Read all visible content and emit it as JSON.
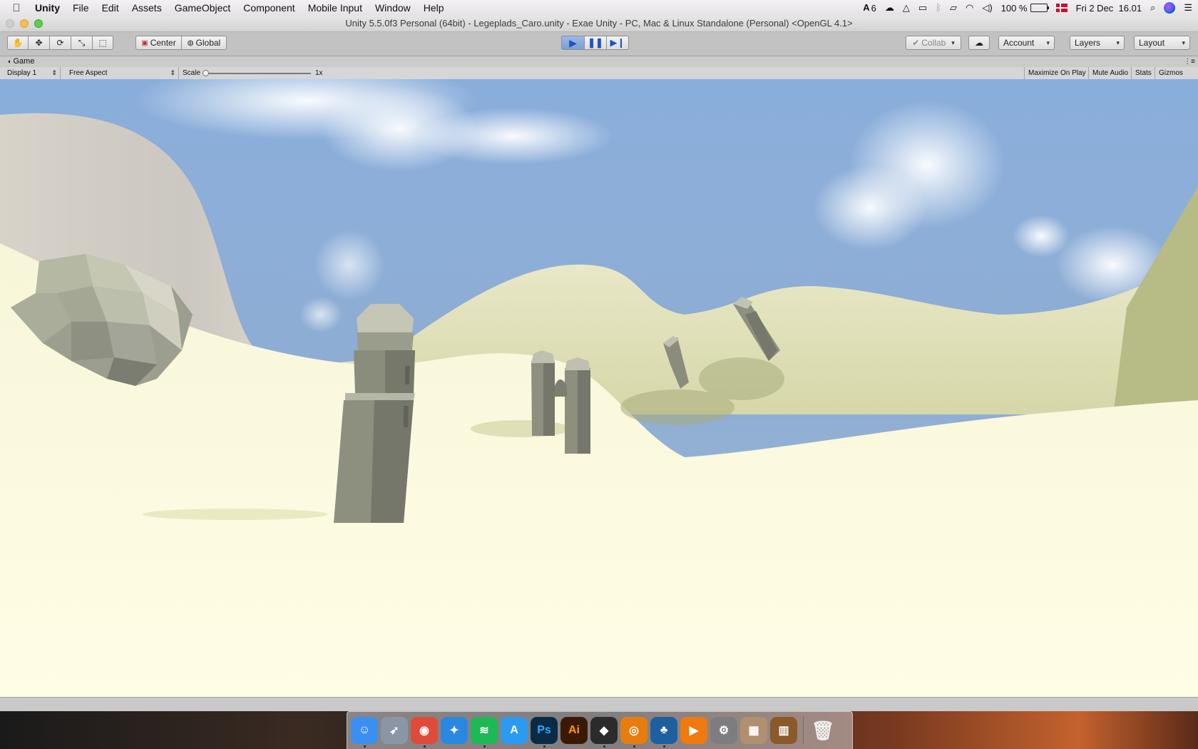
{
  "menubar": {
    "apple_icon": "apple-logo",
    "items": [
      "Unity",
      "File",
      "Edit",
      "Assets",
      "GameObject",
      "Component",
      "Mobile Input",
      "Window",
      "Help"
    ],
    "status": {
      "adobe_count": "6",
      "battery": "100 %",
      "datetime": "Fri 2 Dec  16.01"
    }
  },
  "window": {
    "title": "Unity 5.5.0f3 Personal (64bit) - Legeplads_Caro.unity - Exae Unity - PC, Mac & Linux Standalone (Personal) <OpenGL 4.1>"
  },
  "toolbar": {
    "tools": [
      "hand-icon",
      "move-icon",
      "rotate-icon",
      "scale-icon",
      "rect-tool-icon"
    ],
    "pivot_label": "Center",
    "space_label": "Global",
    "play_controls": [
      "play-icon",
      "pause-icon",
      "step-icon"
    ],
    "collab_label": "Collab",
    "account_label": "Account",
    "layers_label": "Layers",
    "layout_label": "Layout"
  },
  "game_view": {
    "tab_label": "Game",
    "display": "Display 1",
    "aspect": "Free Aspect",
    "scale_label": "Scale",
    "scale_value": "1x",
    "scale_fraction": 0,
    "maximize_label": "Maximize On Play",
    "mute_label": "Mute Audio",
    "stats_label": "Stats",
    "gizmos_label": "Gizmos"
  },
  "dock": {
    "apps": [
      {
        "name": "Finder",
        "icon": "finder-icon",
        "color": "#3b8ff0",
        "glyph": "☺",
        "running": true
      },
      {
        "name": "Launchpad",
        "icon": "rocket-icon",
        "color": "#8a96a6",
        "glyph": "🚀",
        "running": false
      },
      {
        "name": "Chrome",
        "icon": "chrome-icon",
        "color": "#e04a3a",
        "glyph": "◉",
        "running": true
      },
      {
        "name": "Safari",
        "icon": "compass-icon",
        "color": "#2a88e0",
        "glyph": "✦",
        "running": false
      },
      {
        "name": "Spotify",
        "icon": "spotify-icon",
        "color": "#1db954",
        "glyph": "≋",
        "running": true
      },
      {
        "name": "App Store",
        "icon": "app-store-icon",
        "color": "#2a9bf0",
        "glyph": "A",
        "running": false
      },
      {
        "name": "Photoshop",
        "icon": "photoshop-icon",
        "color": "#0b2b45",
        "glyph": "Ps",
        "running": true
      },
      {
        "name": "Illustrator",
        "icon": "illustrator-icon",
        "color": "#3a1a05",
        "glyph": "Ai",
        "running": false
      },
      {
        "name": "Unity",
        "icon": "unity-icon",
        "color": "#2b2b2b",
        "glyph": "◆",
        "running": true
      },
      {
        "name": "Blender",
        "icon": "blender-icon",
        "color": "#e87d0d",
        "glyph": "◎",
        "running": true
      },
      {
        "name": "SourceTree",
        "icon": "tree-icon",
        "color": "#1e5fa0",
        "glyph": "♣",
        "running": true
      },
      {
        "name": "Infuse",
        "icon": "play-arrow-icon",
        "color": "#f07a10",
        "glyph": "▶",
        "running": false
      },
      {
        "name": "System Preferences",
        "icon": "gear-icon",
        "color": "#7d7d80",
        "glyph": "⚙",
        "running": false
      },
      {
        "name": "Calculator",
        "icon": "grid-doc-icon",
        "color": "#b09070",
        "glyph": "▦",
        "running": false
      },
      {
        "name": "iBooks",
        "icon": "books-icon",
        "color": "#8a5a2a",
        "glyph": "▥",
        "running": false
      }
    ],
    "trash_icon": "trash-icon"
  },
  "colors": {
    "sky_top": "#8aaedb",
    "sand": "#fffde0",
    "stone": "#8a8d7c",
    "play_active": "#7d9fd6"
  }
}
